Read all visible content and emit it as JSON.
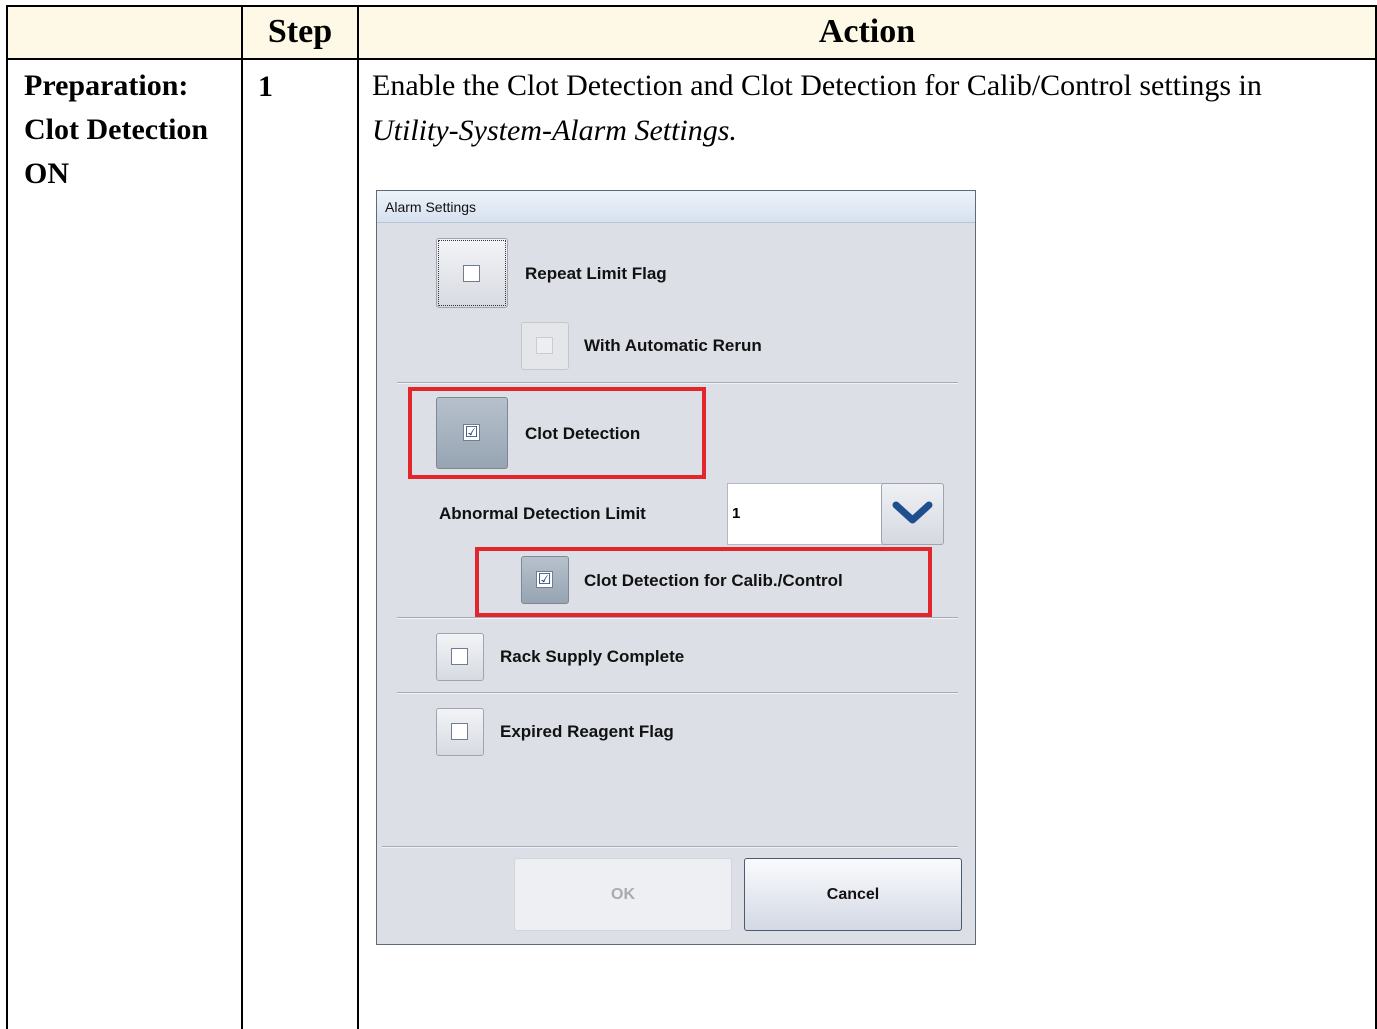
{
  "table": {
    "header_step": "Step",
    "header_action": "Action",
    "row": {
      "title_lines": [
        "Preparation:",
        "Clot Detection",
        "ON"
      ],
      "step_number": "1",
      "action_text": "Enable the Clot Detection and Clot Detection for Calib/Control settings in",
      "action_path": "Utility-System-Alarm Settings."
    }
  },
  "dialog": {
    "title": "Alarm Settings",
    "repeat_limit_flag": {
      "label": "Repeat Limit Flag",
      "checked": false
    },
    "with_automatic_rerun": {
      "label": "With Automatic Rerun",
      "checked": false,
      "enabled": false
    },
    "clot_detection": {
      "label": "Clot Detection",
      "checked": true
    },
    "abnormal_detection_limit": {
      "label": "Abnormal Detection Limit",
      "value": "1"
    },
    "clot_detection_calib": {
      "label": "Clot Detection for Calib./Control",
      "checked": true
    },
    "rack_supply_complete": {
      "label": "Rack Supply Complete",
      "checked": false
    },
    "expired_reagent_flag": {
      "label": "Expired Reagent Flag",
      "checked": false
    },
    "ok_label": "OK",
    "cancel_label": "Cancel"
  },
  "colors": {
    "header_bg": "#fdf9e6",
    "highlight": "#e3262c",
    "dialog_bg": "#dcdfe6"
  },
  "icons": {
    "checkmark": "checkmark-icon",
    "chevron": "chevron-down-icon"
  }
}
